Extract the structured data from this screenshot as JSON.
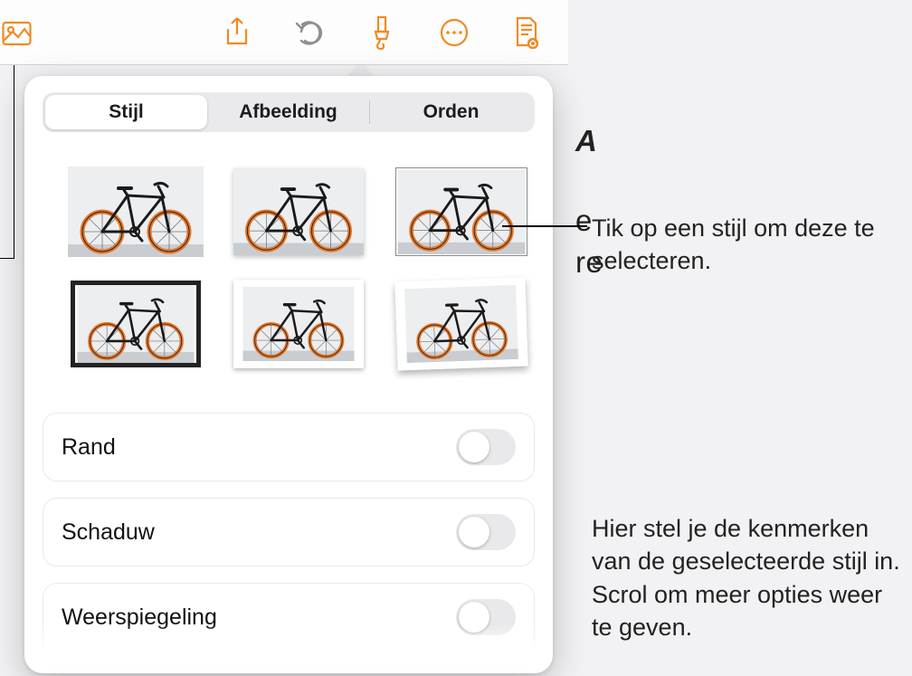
{
  "toolbar": {
    "icons": [
      "photos-icon",
      "share-icon",
      "undo-icon",
      "format-brush-icon",
      "more-icon",
      "document-preview-icon"
    ]
  },
  "tabs": [
    {
      "id": "stijl",
      "label": "Stijl",
      "selected": true
    },
    {
      "id": "afbeelding",
      "label": "Afbeelding",
      "selected": false
    },
    {
      "id": "orden",
      "label": "Orden",
      "selected": false
    }
  ],
  "style_thumbs": [
    {
      "id": "plain"
    },
    {
      "id": "shadow"
    },
    {
      "id": "thin-border"
    },
    {
      "id": "thick-border"
    },
    {
      "id": "white-frame"
    },
    {
      "id": "tilted-frame"
    }
  ],
  "options": [
    {
      "id": "rand",
      "label": "Rand",
      "on": false
    },
    {
      "id": "schaduw",
      "label": "Schaduw",
      "on": false
    },
    {
      "id": "weerspiegeling",
      "label": "Weerspiegeling",
      "on": false
    }
  ],
  "callouts": {
    "c1": "Tik op een stijl om deze te selecteren.",
    "c2": "Hier stel je de kenmerken van de geselecteerde stijl in. Scrol om meer opties weer te geven."
  },
  "background_text_fragments": [
    "A",
    "e",
    "re"
  ]
}
